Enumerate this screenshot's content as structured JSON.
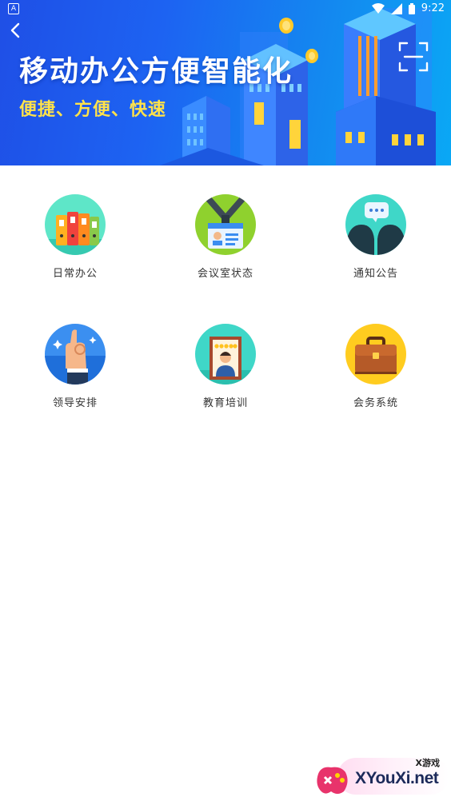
{
  "status": {
    "indicator": "A",
    "time": "9:22"
  },
  "banner": {
    "title": "移动办公方便智能化",
    "subtitle": "便捷、方便、快速"
  },
  "menu": [
    {
      "label": "日常办公",
      "icon": "binders-icon"
    },
    {
      "label": "会议室状态",
      "icon": "id-badge-icon"
    },
    {
      "label": "通知公告",
      "icon": "chat-bubbles-icon"
    },
    {
      "label": "领导安排",
      "icon": "ok-hand-icon"
    },
    {
      "label": "教育培训",
      "icon": "certificate-icon"
    },
    {
      "label": "会务系统",
      "icon": "briefcase-icon"
    }
  ],
  "watermark": {
    "top": "X游戏",
    "site": "XYouXi.net"
  },
  "colors": {
    "banner_start": "#1f4fe6",
    "banner_end": "#0aa8f5",
    "subtitle": "#ffe24a"
  }
}
